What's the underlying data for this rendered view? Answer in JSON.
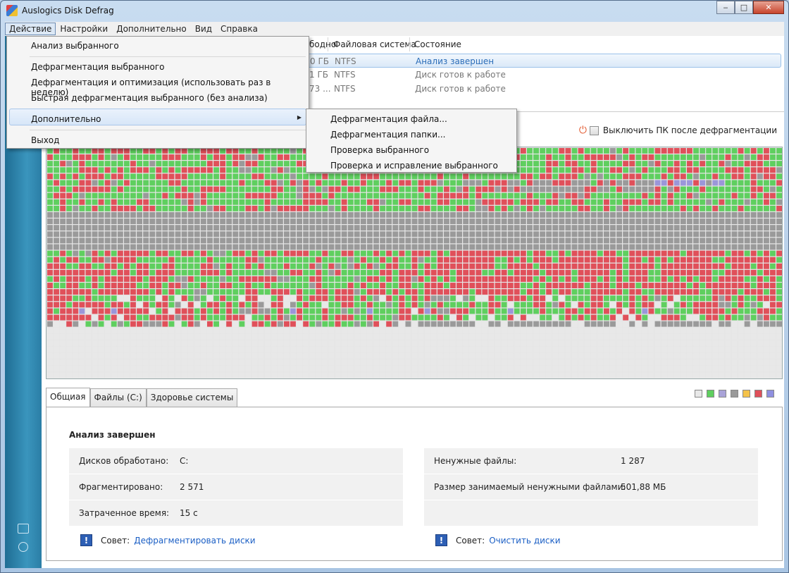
{
  "window": {
    "title": "Auslogics Disk Defrag",
    "minimize": "‒",
    "maximize": "□",
    "close": "✕"
  },
  "menubar": [
    "Действие",
    "Настройки",
    "Дополнительно",
    "Вид",
    "Справка"
  ],
  "drives": {
    "headers": {
      "free": "бодно",
      "fs": "Файловая система",
      "state": "Состояние"
    },
    "rows": [
      {
        "free": "0 ГБ",
        "fs": "NTFS",
        "state": "Анализ завершен"
      },
      {
        "free": "1 ГБ",
        "fs": "NTFS",
        "state": "Диск готов к работе"
      },
      {
        "free": "73 ...",
        "fs": "NTFS",
        "state": "Диск готов к работе"
      }
    ]
  },
  "shutdown_label": "Выключить ПК после дефрагментации",
  "tabs": [
    "Общиая",
    "Файлы (C:)",
    "Здоровье системы"
  ],
  "legend_colors": [
    "#e8e8e8",
    "#5fcf5f",
    "#a9a3d8",
    "#9a9a9a",
    "#f4c24a",
    "#e0505a",
    "#8f90e0"
  ],
  "panel": {
    "title": "Анализ завершен",
    "left": [
      {
        "k": "Дисков обработано:",
        "v": "C:"
      },
      {
        "k": "Фрагментировано:",
        "v": "2 571"
      },
      {
        "k": "Затраченное время:",
        "v": "15 с"
      }
    ],
    "right": [
      {
        "k": "Ненужные файлы:",
        "v": "1 287"
      },
      {
        "k": "Размер занимаемый ненужными файлами:",
        "v": "501,88 МБ"
      },
      {
        "k": "",
        "v": ""
      }
    ],
    "tip_label": "Совет:",
    "tip_left": "Дефрагментировать диски",
    "tip_right": "Очистить диски"
  },
  "menu": {
    "items": [
      "Анализ выбранного",
      "Дефрагментация выбранного",
      "Дефрагментация и оптимизация (использовать раз в неделю)",
      "Быстрая дефрагментация выбранного (без анализа)",
      "Дополнительно",
      "Выход"
    ],
    "submenu": [
      "Дефрагментация файла...",
      "Дефрагментация папки...",
      "Проверка выбранного",
      "Проверка и исправление выбранного"
    ]
  },
  "diskmap_colors": {
    "used": "#5fcf5f",
    "fragmented": "#e0505a",
    "system": "#9a9a9a",
    "free": "#e8e8e8",
    "mft": "#9b96d9"
  }
}
